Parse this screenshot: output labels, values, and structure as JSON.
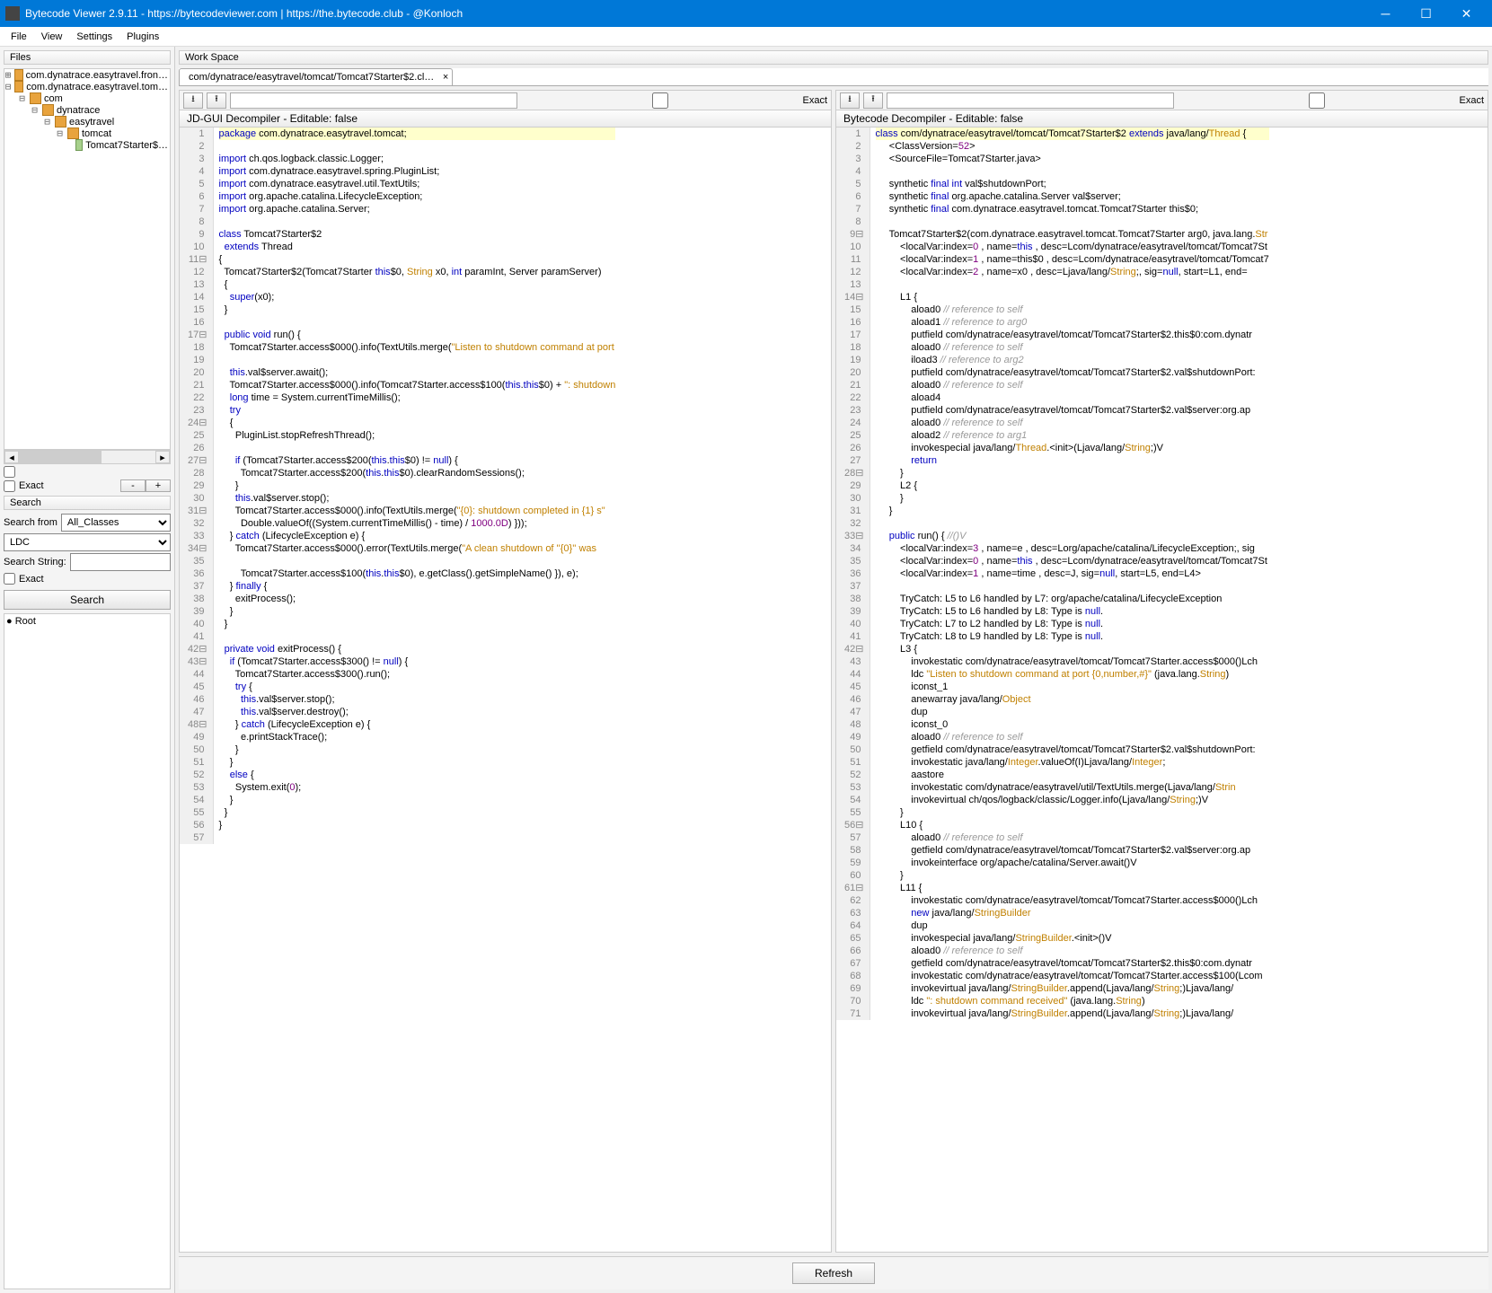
{
  "window": {
    "title": "Bytecode Viewer 2.9.11 - https://bytecodeviewer.com | https://the.bytecode.club - @Konloch"
  },
  "menu": {
    "file": "File",
    "view": "View",
    "settings": "Settings",
    "plugins": "Plugins"
  },
  "files_label": "Files",
  "tree": [
    {
      "indent": 0,
      "handle": "⊞",
      "icon": "pkg",
      "label": "com.dynatrace.easytravel.fron…"
    },
    {
      "indent": 0,
      "handle": "⊟",
      "icon": "pkg",
      "label": "com.dynatrace.easytravel.tom…"
    },
    {
      "indent": 1,
      "handle": "⊟",
      "icon": "pkg",
      "label": "com"
    },
    {
      "indent": 2,
      "handle": "⊟",
      "icon": "pkg",
      "label": "dynatrace"
    },
    {
      "indent": 3,
      "handle": "⊟",
      "icon": "pkg",
      "label": "easytravel"
    },
    {
      "indent": 4,
      "handle": "⊟",
      "icon": "pkg",
      "label": "tomcat"
    },
    {
      "indent": 5,
      "handle": " ",
      "icon": "cls",
      "label": "Tomcat7Starter$…"
    }
  ],
  "exact_label": "Exact",
  "minus": "-",
  "plus": "+",
  "search": {
    "label": "Search",
    "from_lbl": "Search from",
    "from_val": "All_Classes",
    "type_val": "LDC",
    "str_lbl": "Search String:",
    "str_val": "",
    "btn": "Search"
  },
  "results": [
    "Root"
  ],
  "workspace_lbl": "Work Space",
  "tab_label": "com/dynatrace/easytravel/tomcat/Tomcat7Starter$2.cl…",
  "left_pane_title": "JD-GUI Decompiler - Editable: false",
  "right_pane_title": "Bytecode Decompiler - Editable: false",
  "refresh": "Refresh",
  "left_markers": {
    "11": "⊟",
    "17": "⊟",
    "24": "⊟",
    "27": "⊟",
    "31": "⊟",
    "34": "⊟",
    "42": "⊟",
    "43": "⊟",
    "48": "⊟"
  },
  "right_markers": {
    "9": "⊟",
    "14": "⊟",
    "28": "⊟",
    "33": "⊟",
    "42": "⊟",
    "56": "⊟",
    "61": "⊟"
  },
  "left_code": [
    {
      "n": 1,
      "hl": true,
      "h": "<span class='kw'>package</span> com.dynatrace.easytravel.tomcat;"
    },
    {
      "n": 2,
      "h": ""
    },
    {
      "n": 3,
      "h": "<span class='kw'>import</span> ch.qos.logback.classic.Logger;"
    },
    {
      "n": 4,
      "h": "<span class='kw'>import</span> com.dynatrace.easytravel.spring.PluginList;"
    },
    {
      "n": 5,
      "h": "<span class='kw'>import</span> com.dynatrace.easytravel.util.TextUtils;"
    },
    {
      "n": 6,
      "h": "<span class='kw'>import</span> org.apache.catalina.LifecycleException;"
    },
    {
      "n": 7,
      "h": "<span class='kw'>import</span> org.apache.catalina.Server;"
    },
    {
      "n": 8,
      "h": ""
    },
    {
      "n": 9,
      "h": "<span class='kw'>class</span> Tomcat7Starter$2"
    },
    {
      "n": 10,
      "h": "  <span class='kw'>extends</span> Thread"
    },
    {
      "n": 11,
      "h": "{"
    },
    {
      "n": 12,
      "h": "  Tomcat7Starter$2(Tomcat7Starter <span class='kw'>this</span>$0, <span class='typ'>String</span> x0, <span class='kw'>int</span> paramInt, Server paramServer)"
    },
    {
      "n": 13,
      "h": "  {"
    },
    {
      "n": 14,
      "h": "    <span class='kw'>super</span>(x0);"
    },
    {
      "n": 15,
      "h": "  }"
    },
    {
      "n": 16,
      "h": ""
    },
    {
      "n": 17,
      "h": "  <span class='kw'>public void</span> run() {"
    },
    {
      "n": 18,
      "h": "    Tomcat7Starter.access$000().info(TextUtils.merge(<span class='str'>\"Listen to shutdown command at port</span>"
    },
    {
      "n": 19,
      "h": ""
    },
    {
      "n": 20,
      "h": "    <span class='kw'>this</span>.val$server.await();"
    },
    {
      "n": 21,
      "h": "    Tomcat7Starter.access$000().info(Tomcat7Starter.access$100(<span class='kw'>this</span>.<span class='kw'>this</span>$0) + <span class='str'>\": shutdown</span>"
    },
    {
      "n": 22,
      "h": "    <span class='kw'>long</span> time = System.currentTimeMillis();"
    },
    {
      "n": 23,
      "h": "    <span class='kw'>try</span>"
    },
    {
      "n": 24,
      "h": "    {"
    },
    {
      "n": 25,
      "h": "      PluginList.stopRefreshThread();"
    },
    {
      "n": 26,
      "h": ""
    },
    {
      "n": 27,
      "h": "      <span class='kw'>if</span> (Tomcat7Starter.access$200(<span class='kw'>this</span>.<span class='kw'>this</span>$0) != <span class='kw'>null</span>) {"
    },
    {
      "n": 28,
      "h": "        Tomcat7Starter.access$200(<span class='kw'>this</span>.<span class='kw'>this</span>$0).clearRandomSessions();"
    },
    {
      "n": 29,
      "h": "      }"
    },
    {
      "n": 30,
      "h": "      <span class='kw'>this</span>.val$server.stop();"
    },
    {
      "n": 31,
      "h": "      Tomcat7Starter.access$000().info(TextUtils.merge(<span class='str'>\"{0}: shutdown completed in {1} s\"</span>"
    },
    {
      "n": 32,
      "h": "        Double.valueOf((System.currentTimeMillis() - time) / <span class='num'>1000.0D</span>) }));"
    },
    {
      "n": 33,
      "h": "    } <span class='kw'>catch</span> (LifecycleException e) {"
    },
    {
      "n": 34,
      "h": "      Tomcat7Starter.access$000().error(TextUtils.merge(<span class='str'>\"A clean shutdown of ''{0}'' was</span>"
    },
    {
      "n": 35,
      "h": ""
    },
    {
      "n": 36,
      "h": "        Tomcat7Starter.access$100(<span class='kw'>this</span>.<span class='kw'>this</span>$0), e.getClass().getSimpleName() }), e);"
    },
    {
      "n": 37,
      "h": "    } <span class='kw'>finally</span> {"
    },
    {
      "n": 38,
      "h": "      exitProcess();"
    },
    {
      "n": 39,
      "h": "    }"
    },
    {
      "n": 40,
      "h": "  }"
    },
    {
      "n": 41,
      "h": ""
    },
    {
      "n": 42,
      "h": "  <span class='kw'>private void</span> exitProcess() {"
    },
    {
      "n": 43,
      "h": "    <span class='kw'>if</span> (Tomcat7Starter.access$300() != <span class='kw'>null</span>) {"
    },
    {
      "n": 44,
      "h": "      Tomcat7Starter.access$300().run();"
    },
    {
      "n": 45,
      "h": "      <span class='kw'>try</span> {"
    },
    {
      "n": 46,
      "h": "        <span class='kw'>this</span>.val$server.stop();"
    },
    {
      "n": 47,
      "h": "        <span class='kw'>this</span>.val$server.destroy();"
    },
    {
      "n": 48,
      "h": "      } <span class='kw'>catch</span> (LifecycleException e) {"
    },
    {
      "n": 49,
      "h": "        e.printStackTrace();"
    },
    {
      "n": 50,
      "h": "      }"
    },
    {
      "n": 51,
      "h": "    }"
    },
    {
      "n": 52,
      "h": "    <span class='kw'>else</span> {"
    },
    {
      "n": 53,
      "h": "      System.exit(<span class='num'>0</span>);"
    },
    {
      "n": 54,
      "h": "    }"
    },
    {
      "n": 55,
      "h": "  }"
    },
    {
      "n": 56,
      "h": "}"
    },
    {
      "n": 57,
      "h": ""
    }
  ],
  "right_code": [
    {
      "n": 1,
      "hl": true,
      "h": "<span class='kw'>class</span> com/dynatrace/easytravel/tomcat/Tomcat7Starter$2 <span class='kw'>extends</span> java/lang/<span class='typ'>Thread</span> {"
    },
    {
      "n": 2,
      "h": "     &lt;ClassVersion=<span class='num'>52</span>&gt;"
    },
    {
      "n": 3,
      "h": "     &lt;SourceFile=Tomcat7Starter.java&gt;"
    },
    {
      "n": 4,
      "h": ""
    },
    {
      "n": 5,
      "h": "     synthetic <span class='kw'>final int</span> val$shutdownPort;"
    },
    {
      "n": 6,
      "h": "     synthetic <span class='kw'>final</span> org.apache.catalina.Server val$server;"
    },
    {
      "n": 7,
      "h": "     synthetic <span class='kw'>final</span> com.dynatrace.easytravel.tomcat.Tomcat7Starter this$0;"
    },
    {
      "n": 8,
      "h": ""
    },
    {
      "n": 9,
      "h": "     Tomcat7Starter$2(com.dynatrace.easytravel.tomcat.Tomcat7Starter arg0, java.lang.<span class='typ'>Str</span>"
    },
    {
      "n": 10,
      "h": "         &lt;localVar:index=<span class='num'>0</span> , name=<span class='kw'>this</span> , desc=Lcom/dynatrace/easytravel/tomcat/Tomcat7St"
    },
    {
      "n": 11,
      "h": "         &lt;localVar:index=<span class='num'>1</span> , name=this$0 , desc=Lcom/dynatrace/easytravel/tomcat/Tomcat7"
    },
    {
      "n": 12,
      "h": "         &lt;localVar:index=<span class='num'>2</span> , name=x0 , desc=Ljava/lang/<span class='typ'>String</span>;, sig=<span class='kw'>null</span>, start=L1, end="
    },
    {
      "n": 13,
      "h": ""
    },
    {
      "n": 14,
      "h": "         L1 {"
    },
    {
      "n": 15,
      "h": "             aload0 <span class='cmt'>// reference to self</span>"
    },
    {
      "n": 16,
      "h": "             aload1 <span class='cmt'>// reference to arg0</span>"
    },
    {
      "n": 17,
      "h": "             putfield com/dynatrace/easytravel/tomcat/Tomcat7Starter$2.this$0:com.dynatr"
    },
    {
      "n": 18,
      "h": "             aload0 <span class='cmt'>// reference to self</span>"
    },
    {
      "n": 19,
      "h": "             iload3 <span class='cmt'>// reference to arg2</span>"
    },
    {
      "n": 20,
      "h": "             putfield com/dynatrace/easytravel/tomcat/Tomcat7Starter$2.val$shutdownPort:"
    },
    {
      "n": 21,
      "h": "             aload0 <span class='cmt'>// reference to self</span>"
    },
    {
      "n": 22,
      "h": "             aload4"
    },
    {
      "n": 23,
      "h": "             putfield com/dynatrace/easytravel/tomcat/Tomcat7Starter$2.val$server:org.ap"
    },
    {
      "n": 24,
      "h": "             aload0 <span class='cmt'>// reference to self</span>"
    },
    {
      "n": 25,
      "h": "             aload2 <span class='cmt'>// reference to arg1</span>"
    },
    {
      "n": 26,
      "h": "             invokespecial java/lang/<span class='typ'>Thread</span>.&lt;init&gt;(Ljava/lang/<span class='typ'>String</span>;)V"
    },
    {
      "n": 27,
      "h": "             <span class='kw'>return</span>"
    },
    {
      "n": 28,
      "h": "         }"
    },
    {
      "n": 29,
      "h": "         L2 {"
    },
    {
      "n": 30,
      "h": "         }"
    },
    {
      "n": 31,
      "h": "     }"
    },
    {
      "n": 32,
      "h": ""
    },
    {
      "n": 33,
      "h": "     <span class='kw'>public</span> run() { <span class='cmt'>//()V</span>"
    },
    {
      "n": 34,
      "h": "         &lt;localVar:index=<span class='num'>3</span> , name=e , desc=Lorg/apache/catalina/LifecycleException;, sig"
    },
    {
      "n": 35,
      "h": "         &lt;localVar:index=<span class='num'>0</span> , name=<span class='kw'>this</span> , desc=Lcom/dynatrace/easytravel/tomcat/Tomcat7St"
    },
    {
      "n": 36,
      "h": "         &lt;localVar:index=<span class='num'>1</span> , name=time , desc=J, sig=<span class='kw'>null</span>, start=L5, end=L4&gt;"
    },
    {
      "n": 37,
      "h": ""
    },
    {
      "n": 38,
      "h": "         TryCatch: L5 to L6 handled by L7: org/apache/catalina/LifecycleException"
    },
    {
      "n": 39,
      "h": "         TryCatch: L5 to L6 handled by L8: Type is <span class='kw'>null</span>."
    },
    {
      "n": 40,
      "h": "         TryCatch: L7 to L2 handled by L8: Type is <span class='kw'>null</span>."
    },
    {
      "n": 41,
      "h": "         TryCatch: L8 to L9 handled by L8: Type is <span class='kw'>null</span>."
    },
    {
      "n": 42,
      "h": "         L3 {"
    },
    {
      "n": 43,
      "h": "             invokestatic com/dynatrace/easytravel/tomcat/Tomcat7Starter.access$000()Lch"
    },
    {
      "n": 44,
      "h": "             ldc <span class='str'>\"Listen to shutdown command at port {0,number,#}\"</span> (java.lang.<span class='typ'>String</span>)"
    },
    {
      "n": 45,
      "h": "             iconst_1"
    },
    {
      "n": 46,
      "h": "             anewarray java/lang/<span class='typ'>Object</span>"
    },
    {
      "n": 47,
      "h": "             dup"
    },
    {
      "n": 48,
      "h": "             iconst_0"
    },
    {
      "n": 49,
      "h": "             aload0 <span class='cmt'>// reference to self</span>"
    },
    {
      "n": 50,
      "h": "             getfield com/dynatrace/easytravel/tomcat/Tomcat7Starter$2.val$shutdownPort:"
    },
    {
      "n": 51,
      "h": "             invokestatic java/lang/<span class='typ'>Integer</span>.valueOf(I)Ljava/lang/<span class='typ'>Integer</span>;"
    },
    {
      "n": 52,
      "h": "             aastore"
    },
    {
      "n": 53,
      "h": "             invokestatic com/dynatrace/easytravel/util/TextUtils.merge(Ljava/lang/<span class='typ'>Strin</span>"
    },
    {
      "n": 54,
      "h": "             invokevirtual ch/qos/logback/classic/Logger.info(Ljava/lang/<span class='typ'>String</span>;)V"
    },
    {
      "n": 55,
      "h": "         }"
    },
    {
      "n": 56,
      "h": "         L10 {"
    },
    {
      "n": 57,
      "h": "             aload0 <span class='cmt'>// reference to self</span>"
    },
    {
      "n": 58,
      "h": "             getfield com/dynatrace/easytravel/tomcat/Tomcat7Starter$2.val$server:org.ap"
    },
    {
      "n": 59,
      "h": "             invokeinterface org/apache/catalina/Server.await()V"
    },
    {
      "n": 60,
      "h": "         }"
    },
    {
      "n": 61,
      "h": "         L11 {"
    },
    {
      "n": 62,
      "h": "             invokestatic com/dynatrace/easytravel/tomcat/Tomcat7Starter.access$000()Lch"
    },
    {
      "n": 63,
      "h": "             <span class='kw'>new</span> java/lang/<span class='typ'>StringBuilder</span>"
    },
    {
      "n": 64,
      "h": "             dup"
    },
    {
      "n": 65,
      "h": "             invokespecial java/lang/<span class='typ'>StringBuilder</span>.&lt;init&gt;()V"
    },
    {
      "n": 66,
      "h": "             aload0 <span class='cmt'>// reference to self</span>"
    },
    {
      "n": 67,
      "h": "             getfield com/dynatrace/easytravel/tomcat/Tomcat7Starter$2.this$0:com.dynatr"
    },
    {
      "n": 68,
      "h": "             invokestatic com/dynatrace/easytravel/tomcat/Tomcat7Starter.access$100(Lcom"
    },
    {
      "n": 69,
      "h": "             invokevirtual java/lang/<span class='typ'>StringBuilder</span>.append(Ljava/lang/<span class='typ'>String</span>;)Ljava/lang/"
    },
    {
      "n": 70,
      "h": "             ldc <span class='str'>\": shutdown command received\"</span> (java.lang.<span class='typ'>String</span>)"
    },
    {
      "n": 71,
      "h": "             invokevirtual java/lang/<span class='typ'>StringBuilder</span>.append(Ljava/lang/<span class='typ'>String</span>;)Ljava/lang/"
    }
  ]
}
